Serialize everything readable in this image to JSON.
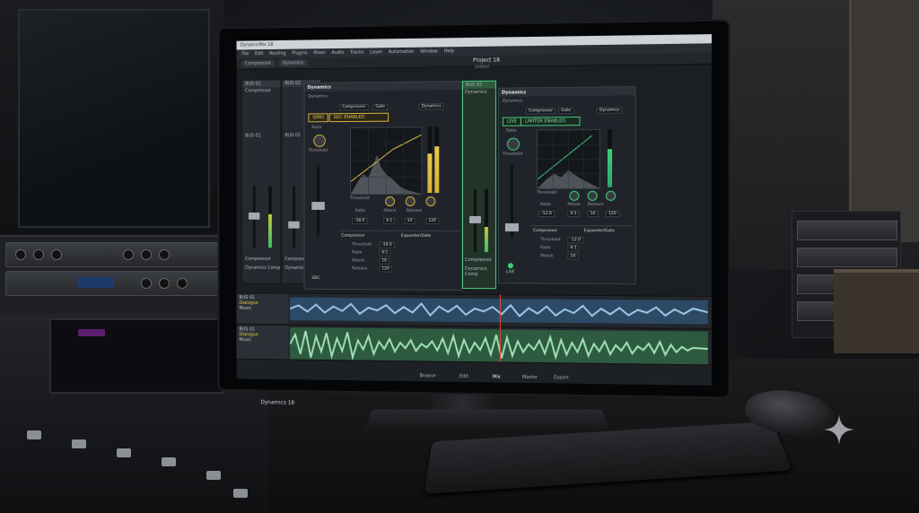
{
  "app": {
    "title_bar": "DynamicMix 18",
    "project_title": "Project 18",
    "project_subtitle": "Untitled",
    "app_name": "Dynamics 18",
    "menu": [
      "File",
      "Edit",
      "Routing",
      "Plugins",
      "Mixer",
      "Audio",
      "Tracks",
      "Layer",
      "Automation",
      "Window",
      "Help"
    ],
    "toolbar": [
      "Compressor",
      "Dynamics"
    ]
  },
  "strips": [
    {
      "name": "BUS 01",
      "sub": "Compressor",
      "send": "BUS 01",
      "bottom": "Compressor",
      "bottom2": "Dynamics Comp"
    },
    {
      "name": "BUS 02",
      "sub": "",
      "send": "BUS 01",
      "bottom": "Compressor",
      "bottom2": "Dynamics Comp"
    },
    {
      "name": "BUS 03",
      "sub": "",
      "send": "BUS 01",
      "bottom": "Dynamics",
      "bottom2": "Compressor"
    }
  ],
  "plugin_left": {
    "title": "Dynamics",
    "section": "Dynamics",
    "dropdowns": [
      "Compressor",
      "Gate",
      "Dynamics"
    ],
    "badge_a": "SIMO",
    "badge_b": "SDC ENABLED",
    "threshold_label": "Threshold",
    "ratio_label": "Ratio",
    "knobs": [
      "Threshold",
      "Ratio",
      "Attack",
      "Release"
    ],
    "values": [
      "-18.0",
      "4:1",
      "10",
      "120"
    ],
    "comp_label": "Compressor",
    "exp_label": "Expander/Gate",
    "rows": [
      [
        "Threshold",
        "-18.0"
      ],
      [
        "Ratio",
        "4:1"
      ],
      [
        "Attack",
        "10"
      ],
      [
        "Release",
        "120"
      ]
    ],
    "bottom": "SDC"
  },
  "plugin_right": {
    "title": "Dynamics",
    "section": "Dynamics",
    "dropdowns": [
      "Compressor",
      "Gate",
      "Dynamics"
    ],
    "badge_a": "LIVE",
    "badge_b": "LIMITER ENABLED",
    "threshold_label": "Threshold",
    "ratio_label": "Ratio",
    "knobs": [
      "Threshold",
      "Ratio",
      "Attack",
      "Release"
    ],
    "values": [
      "-12.0",
      "4:1",
      "10",
      "120"
    ],
    "comp_label": "Compressor",
    "exp_label": "Expander/Gate",
    "rows": [
      [
        "Threshold",
        "-12.0"
      ],
      [
        "Ratio",
        "4:1"
      ],
      [
        "Attack",
        "10"
      ]
    ],
    "bottom": "LIVE"
  },
  "center_strip": {
    "name": "BUS 02",
    "label": "Dynamics",
    "bottom": "Compressor",
    "bottom2": "Dynamics Comp"
  },
  "tracks": [
    {
      "name": "BUS 01",
      "sub": "Dialogue",
      "type": "Music"
    },
    {
      "name": "BUS 01",
      "sub": "Dialogue",
      "type": "Music"
    }
  ],
  "bottom_bar": [
    "Browse",
    "Edit",
    "Mix",
    "Master",
    "Export"
  ],
  "colors": {
    "accent_yellow": "#e8c64a",
    "accent_green": "#3fcf7a",
    "wave_blue": "#7fb1d9",
    "wave_green": "#7ed19b"
  }
}
